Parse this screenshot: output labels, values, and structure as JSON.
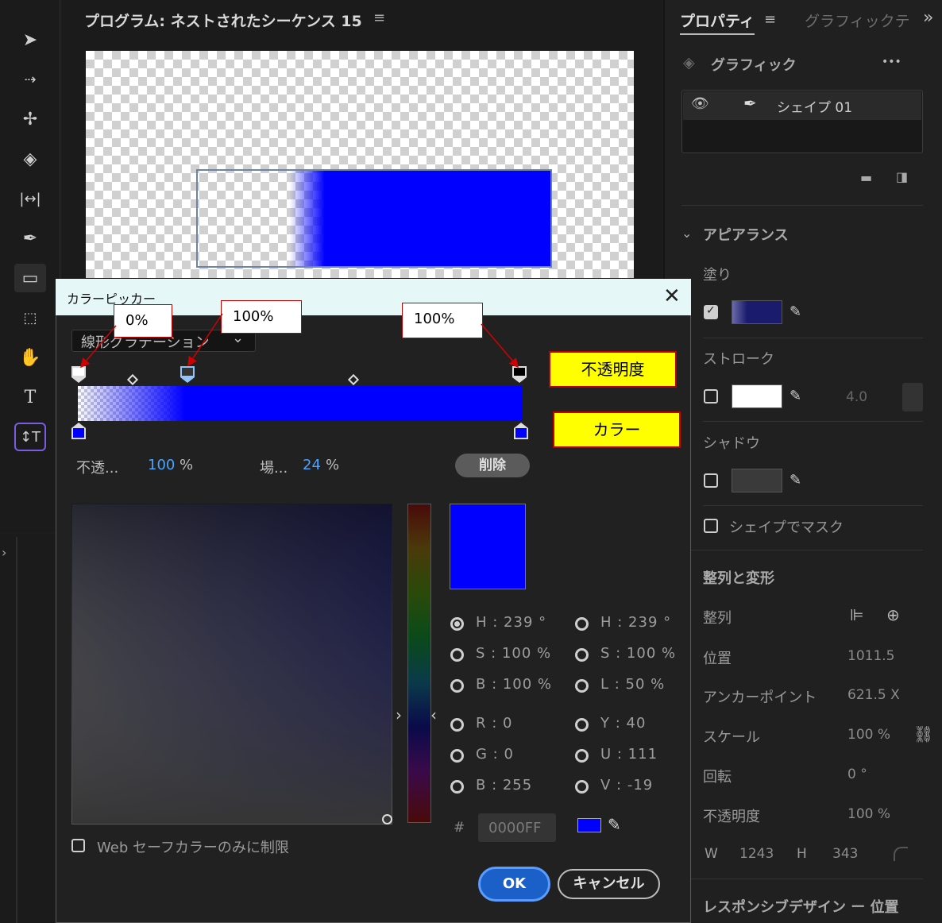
{
  "monitor": {
    "title": "プログラム: ネストされたシーケンス 15",
    "menu_icon": "≡"
  },
  "props": {
    "tab_active": "プロパティ",
    "tab_menu": "≡",
    "tab_inactive": "グラフィックテ",
    "overflow": "»",
    "graphic_label": "グラフィック",
    "more": "•••",
    "layer_name": "シェイプ 01",
    "appearance": "アピアランス",
    "fill": "塗り",
    "stroke": "ストローク",
    "stroke_width": "4.0",
    "shadow": "シャドウ",
    "mask": "シェイプでマスク",
    "align_transform": "整列と変形",
    "align": "整列",
    "position": "位置",
    "position_val": "1011.5",
    "anchor": "アンカーポイント",
    "anchor_val": "621.5 X",
    "scale": "スケール",
    "scale_val": "100 %",
    "rotation": "回転",
    "rotation_val": "0 °",
    "opacity": "不透明度",
    "opacity_val": "100 %",
    "w_label": "W",
    "w_val": "1243",
    "h_label": "H",
    "h_val": "343",
    "responsive": "レスポンシブデザイン ー 位置",
    "colors": {
      "fill_swatch": "#1b1b6e",
      "stroke_swatch": "#ffffff",
      "shadow_swatch": "#3a3a3a"
    }
  },
  "dialog": {
    "title": "カラーピッカー",
    "close": "✕",
    "gradient_type": "線形グラデーション",
    "opacity_label": "不透...",
    "opacity_value": "100",
    "opacity_unit": "%",
    "location_label": "場...",
    "location_value": "24",
    "location_unit": "%",
    "delete": "削除",
    "color_hex": "#0000ff",
    "hsb_h": "H : 239 °",
    "hsb_s": "S : 100 %",
    "hsb_b": "B : 100 %",
    "hsl_h": "H : 239 °",
    "hsl_s": "S : 100 %",
    "hsl_l": "L : 50 %",
    "r": "R : 0",
    "g": "G : 0",
    "b": "B : 255",
    "y": "Y : 40",
    "u": "U : 111",
    "v": "V : -19",
    "hash": "#",
    "hex": "0000FF",
    "websafe": "Web セーフカラーのみに制限",
    "ok": "OK",
    "cancel": "キャンセル"
  },
  "callouts": {
    "stop0": "0%",
    "stop_mid": "100%",
    "stop_end": "100%",
    "opacity_label": "不透明度",
    "color_label": "カラー"
  }
}
